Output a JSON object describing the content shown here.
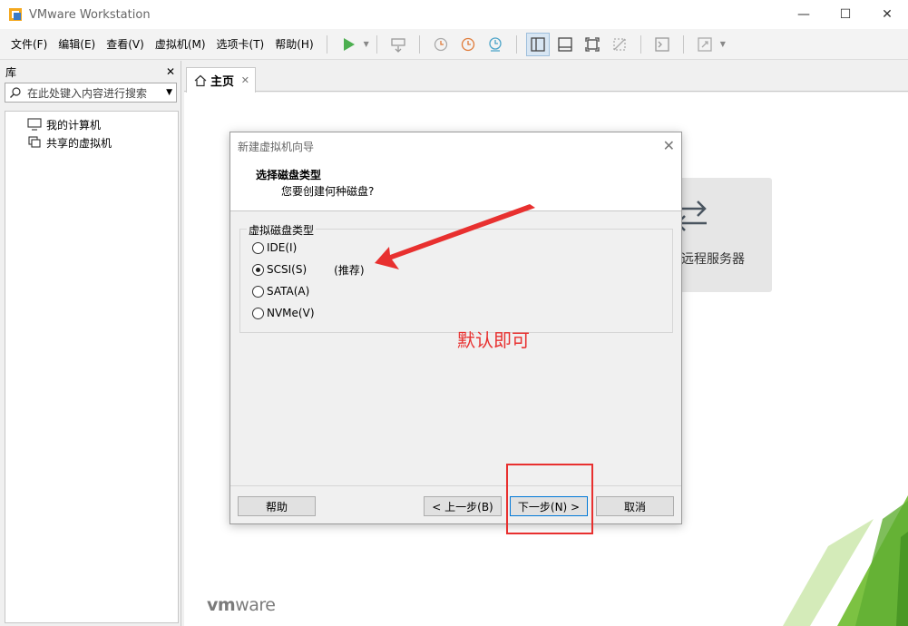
{
  "window": {
    "title": "VMware Workstation",
    "minimize": "—",
    "maximize": "☐",
    "close": "✕"
  },
  "menu": [
    "文件(F)",
    "编辑(E)",
    "查看(V)",
    "虚拟机(M)",
    "选项卡(T)",
    "帮助(H)"
  ],
  "library": {
    "title": "库",
    "close": "✕",
    "search_placeholder": "在此处键入内容进行搜索",
    "items": [
      "我的计算机",
      "共享的虚拟机"
    ]
  },
  "tab": {
    "label": "主页",
    "close": "✕"
  },
  "home": {
    "remote_label": "远程服务器",
    "logo_vm": "vm",
    "logo_ware": "ware"
  },
  "dialog": {
    "title": "新建虚拟机向导",
    "close": "✕",
    "heading": "选择磁盘类型",
    "subheading": "您要创建何种磁盘?",
    "group_label": "虚拟磁盘类型",
    "options": [
      {
        "label": "IDE(I)",
        "checked": false
      },
      {
        "label": "SCSI(S)",
        "checked": true,
        "note": "(推荐)"
      },
      {
        "label": "SATA(A)",
        "checked": false
      },
      {
        "label": "NVMe(V)",
        "checked": false
      }
    ],
    "buttons": {
      "help": "帮助",
      "back": "< 上一步(B)",
      "next": "下一步(N) >",
      "cancel": "取消"
    }
  },
  "annotation": {
    "text": "默认即可",
    "color": "#e8302f"
  },
  "colors": {
    "accent_green": "#4caf50",
    "annotation_red": "#e8302f",
    "vmware_green": "#7cc242"
  }
}
